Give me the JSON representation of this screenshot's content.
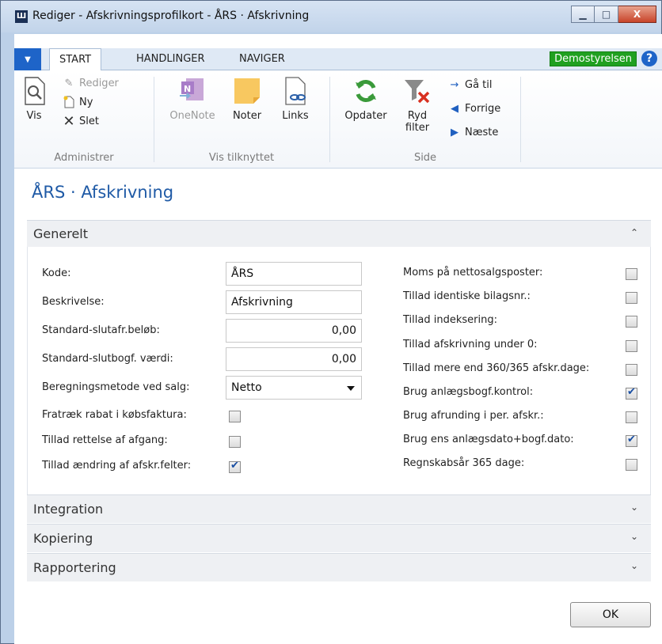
{
  "window": {
    "title": "Rediger - Afskrivningsprofilkort - ÅRS · Afskrivning",
    "app_icon_text": "Ш",
    "minimize_glyph": "▁",
    "maximize_glyph": "□",
    "close_glyph": "X"
  },
  "ribbon_tabs": {
    "menu_glyph": "▼",
    "items": [
      {
        "label": "START"
      },
      {
        "label": "HANDLINGER"
      },
      {
        "label": "NAVIGER"
      }
    ],
    "company": "Demostyrelsen",
    "help_glyph": "?"
  },
  "ribbon": {
    "groups": [
      {
        "label": "Administrer"
      },
      {
        "label": "Vis tilknyttet"
      },
      {
        "label": "Side"
      }
    ],
    "vis": "Vis",
    "rediger": "Rediger",
    "ny": "Ny",
    "slet": "Slet",
    "onenote": "OneNote",
    "noter": "Noter",
    "links": "Links",
    "opdater": "Opdater",
    "ryd_filter_line1": "Ryd",
    "ryd_filter_line2": "filter",
    "ga_til": "Gå til",
    "forrige": "Forrige",
    "naeste": "Næste"
  },
  "page": {
    "title": "ÅRS · Afskrivning"
  },
  "generelt": {
    "header": "Generelt",
    "left_fields": [
      {
        "label": "Kode:",
        "value": "ÅRS"
      },
      {
        "label": "Beskrivelse:",
        "value": "Afskrivning"
      },
      {
        "label": "Standard-slutafr.beløb:",
        "value": "0,00"
      },
      {
        "label": "Standard-slutbogf. værdi:",
        "value": "0,00"
      },
      {
        "label": "Beregningsmetode ved salg:",
        "value": "Netto"
      }
    ],
    "left_checks": [
      {
        "label": "Fratræk rabat i købsfaktura:",
        "checked": false
      },
      {
        "label": "Tillad rettelse af afgang:",
        "checked": false
      },
      {
        "label": "Tillad ændring af afskr.felter:",
        "checked": true
      }
    ],
    "right_checks": [
      {
        "label": "Moms på nettosalgsposter:",
        "checked": false
      },
      {
        "label": "Tillad identiske bilagsnr.:",
        "checked": false
      },
      {
        "label": "Tillad indeksering:",
        "checked": false
      },
      {
        "label": "Tillad afskrivning under 0:",
        "checked": false
      },
      {
        "label": "Tillad mere end 360/365 afskr.dage:",
        "checked": false
      },
      {
        "label": "Brug anlægsbogf.kontrol:",
        "checked": true
      },
      {
        "label": "Brug afrunding i per. afskr.:",
        "checked": false
      },
      {
        "label": "Brug ens anlægsdato+bogf.dato:",
        "checked": true
      },
      {
        "label": "Regnskabsår 365 dage:",
        "checked": false
      }
    ]
  },
  "collapsed_tabs": [
    {
      "label": "Integration"
    },
    {
      "label": "Kopiering"
    },
    {
      "label": "Rapportering"
    }
  ],
  "ok_button": "OK"
}
